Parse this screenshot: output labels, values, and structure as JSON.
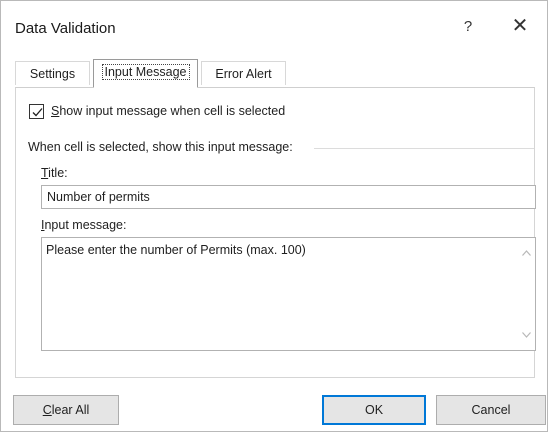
{
  "dialog": {
    "title": "Data Validation",
    "help": "?",
    "close": "✕"
  },
  "tabs": [
    {
      "label": "Settings",
      "active": false
    },
    {
      "label": "Input Message",
      "active": true
    },
    {
      "label": "Error Alert",
      "active": false
    }
  ],
  "checkbox": {
    "prefix": "S",
    "rest": "how input message when cell is selected",
    "checked": true
  },
  "section": {
    "label": "When cell is selected, show this input message:"
  },
  "title_field": {
    "label_prefix": "T",
    "label_rest": "itle:",
    "value": "Number of permits"
  },
  "message_field": {
    "label_prefix": "I",
    "label_rest": "nput message:",
    "value": "Please enter the number of Permits (max. 100)"
  },
  "buttons": {
    "clear_prefix": "C",
    "clear_rest": "lear All",
    "ok": "OK",
    "cancel": "Cancel"
  },
  "colors": {
    "accent": "#0078d7",
    "button_bg": "#e5e5e5"
  }
}
